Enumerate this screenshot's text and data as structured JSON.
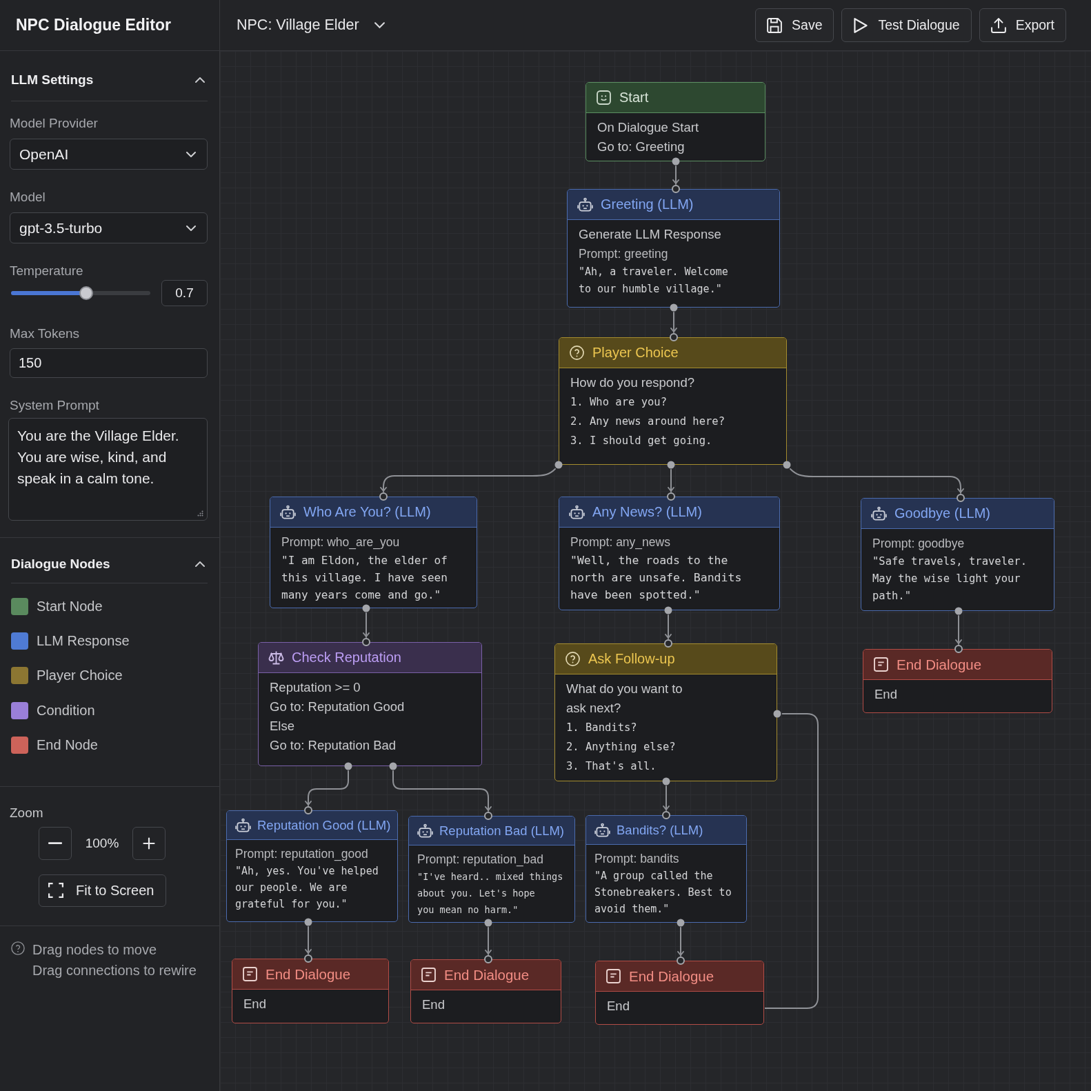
{
  "sidebar": {
    "title": "NPC Dialogue Editor",
    "llm_settings": {
      "heading": "LLM Settings",
      "expanded": true,
      "fields": [
        {
          "kind": "select",
          "label": "Model Provider",
          "value": "OpenAI"
        },
        {
          "kind": "select",
          "label": "Model",
          "value": "gpt-3.5-turbo"
        },
        {
          "kind": "slider",
          "label": "Temperature",
          "level": 0.54,
          "value": "0.7"
        },
        {
          "kind": "input",
          "label": "Max Tokens",
          "value": "150"
        },
        {
          "kind": "textarea",
          "label": "System Prompt",
          "value": "You are the Village Elder.\nYou are wise, kind, and\nspeak in a calm tone."
        }
      ]
    },
    "dialogue_nodes": {
      "heading": "Dialogue Nodes",
      "expanded": true,
      "items": [
        {
          "label": "Start Node",
          "color": "#5a8a5e"
        },
        {
          "label": "LLM Response",
          "color": "#4f7bd4"
        },
        {
          "label": "Player Choice",
          "color": "#8c7632"
        },
        {
          "label": "Condition",
          "color": "#9a7fd8"
        },
        {
          "label": "End Node",
          "color": "#cd635a"
        }
      ]
    },
    "zoom": {
      "label": "Zoom",
      "value": "100%",
      "fit_button": "Fit to Screen"
    },
    "help": [
      "Drag nodes to move",
      "Drag connections to rewire"
    ]
  },
  "toolbar": {
    "npc_selector": "NPC: Village Elder",
    "buttons": [
      {
        "kind": "save",
        "label": "Save"
      },
      {
        "kind": "play",
        "label": "Test Dialogue"
      },
      {
        "kind": "export",
        "label": "Export"
      }
    ]
  },
  "canvas": {
    "nodes": [
      {
        "kind": "start",
        "title": "Start",
        "lines": [
          {
            "kind": "text",
            "text": "On Dialogue Start"
          },
          {
            "kind": "text",
            "text": "Go to: Greeting"
          }
        ]
      },
      {
        "kind": "llm",
        "title": "Greeting (LLM)",
        "lines": [
          {
            "kind": "text",
            "text": "Generate LLM Response"
          },
          {
            "kind": "prompt",
            "text": "Prompt: greeting"
          },
          {
            "kind": "quote",
            "text": "\"Ah, a traveler. Welcome\nto our humble village.\""
          }
        ]
      },
      {
        "kind": "choice",
        "title": "Player Choice",
        "lines": [
          {
            "kind": "text",
            "text": "How do you respond?"
          },
          {
            "kind": "option",
            "text": "1. Who are you?"
          },
          {
            "kind": "option",
            "text": "2. Any news around here?"
          },
          {
            "kind": "option",
            "text": "3. I should get going."
          }
        ]
      },
      {
        "kind": "llm",
        "title": "Who Are You? (LLM)",
        "lines": [
          {
            "kind": "prompt",
            "text": "Prompt: who_are_you"
          },
          {
            "kind": "quote",
            "text": "\"I am Eldon, the elder of\nthis village. I have seen\nmany years come and go.\""
          }
        ]
      },
      {
        "kind": "llm",
        "title": "Any News? (LLM)",
        "lines": [
          {
            "kind": "prompt",
            "text": "Prompt: any_news"
          },
          {
            "kind": "quote",
            "text": "\"Well, the roads to the\nnorth are unsafe. Bandits\nhave been spotted.\""
          }
        ]
      },
      {
        "kind": "llm",
        "title": "Goodbye (LLM)",
        "lines": [
          {
            "kind": "prompt",
            "text": "Prompt: goodbye"
          },
          {
            "kind": "quote",
            "text": "\"Safe travels, traveler.\nMay the wise light your\npath.\""
          }
        ]
      },
      {
        "kind": "condition",
        "title": "Check Reputation",
        "lines": [
          {
            "kind": "text",
            "text": "Reputation >= 0"
          },
          {
            "kind": "text",
            "text": "Go to: Reputation Good"
          },
          {
            "kind": "text",
            "text": "Else"
          },
          {
            "kind": "text",
            "text": "Go to: Reputation Bad"
          }
        ]
      },
      {
        "kind": "choice",
        "title": "Ask Follow-up",
        "lines": [
          {
            "kind": "text",
            "text": "What do you want to\nask next?"
          },
          {
            "kind": "option",
            "text": "1. Bandits?"
          },
          {
            "kind": "option",
            "text": "2. Anything else?"
          },
          {
            "kind": "option",
            "text": "3. That's all."
          }
        ]
      },
      {
        "kind": "end",
        "title": "End Dialogue",
        "lines": [
          {
            "kind": "text",
            "text": "End"
          }
        ]
      },
      {
        "kind": "llm",
        "title": "Reputation Good (LLM)",
        "lines": [
          {
            "kind": "prompt",
            "text": "Prompt: reputation_good"
          },
          {
            "kind": "quote",
            "text": "\"Ah, yes. You've helped\nour people. We are\ngrateful for you.\""
          }
        ]
      },
      {
        "kind": "llm",
        "title": "Reputation Bad (LLM)",
        "lines": [
          {
            "kind": "prompt",
            "text": "Prompt: reputation_bad"
          },
          {
            "kind": "quote",
            "text": "\"I've heard.. mixed things\nabout you. Let's hope\nyou mean no harm.\""
          }
        ]
      },
      {
        "kind": "llm",
        "title": "Bandits? (LLM)",
        "lines": [
          {
            "kind": "prompt",
            "text": "Prompt: bandits"
          },
          {
            "kind": "quote",
            "text": "\"A group called the\nStonebreakers. Best to\navoid them.\""
          }
        ]
      },
      {
        "kind": "end",
        "title": "End Dialogue",
        "lines": [
          {
            "kind": "text",
            "text": "End"
          }
        ]
      },
      {
        "kind": "end",
        "title": "End Dialogue",
        "lines": [
          {
            "kind": "text",
            "text": "End"
          }
        ]
      },
      {
        "kind": "end",
        "title": "End Dialogue",
        "lines": [
          {
            "kind": "text",
            "text": "End"
          }
        ]
      }
    ]
  }
}
